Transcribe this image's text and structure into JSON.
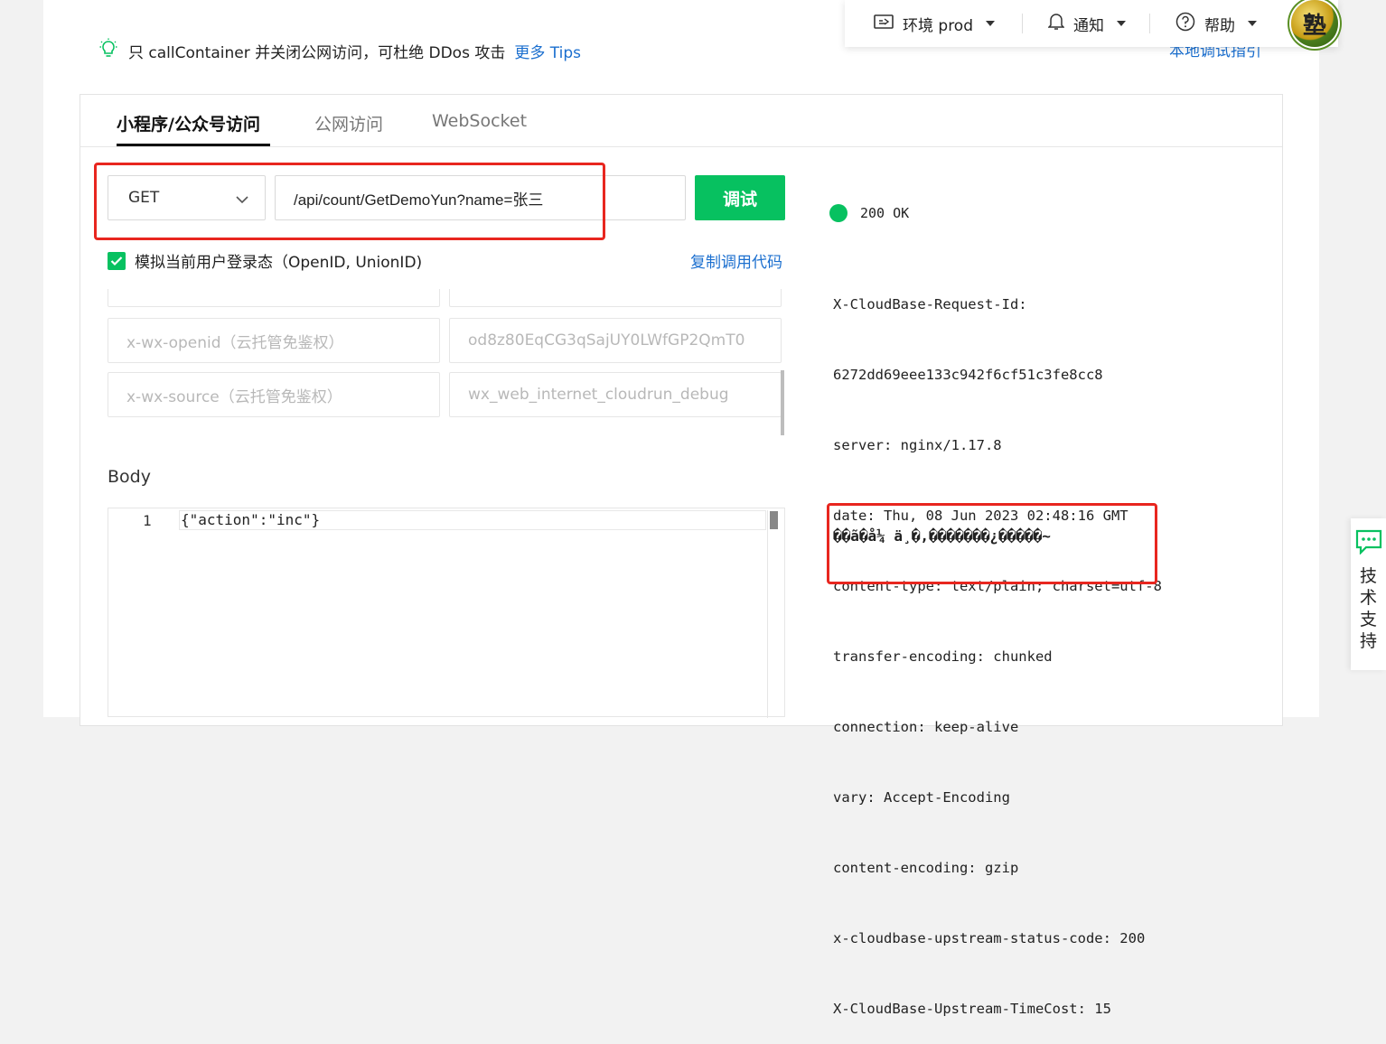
{
  "tip": {
    "text": "只 callContainer 并关闭公网访问，可杜绝 DDos 攻击",
    "more_link": "更多 Tips"
  },
  "topbar": {
    "env_label": "环境 prod",
    "notify_label": "通知",
    "help_label": "帮助",
    "avatar_text": "塾",
    "local_debug_link": "本地调试指引"
  },
  "tabs": [
    {
      "label": "小程序/公众号访问",
      "active": true
    },
    {
      "label": "公网访问",
      "active": false
    },
    {
      "label": "WebSocket",
      "active": false
    }
  ],
  "request": {
    "method": "GET",
    "url": "/api/count/GetDemoYun?name=张三",
    "debug_button": "调试",
    "simulate_login_label": "模拟当前用户登录态（OpenID, UnionID)",
    "simulate_login_checked": true,
    "copy_code_link": "复制调用代码"
  },
  "headers": [
    {
      "key": "x-wx-openid（云托管免鉴权）",
      "value": "od8z80EqCG3qSajUY0LWfGP2QmT0"
    },
    {
      "key": "x-wx-source（云托管免鉴权）",
      "value": "wx_web_internet_cloudrun_debug"
    }
  ],
  "body": {
    "label": "Body",
    "line_number": "1",
    "code": "{\"action\":\"inc\"}"
  },
  "response": {
    "status": "200 OK",
    "status_color": "#07c160",
    "lines": [
      "X-CloudBase-Request-Id:",
      "6272dd69eee133c942f6cf51c3fe8cc8",
      "server: nginx/1.17.8",
      "date: Thu, 08 Jun 2023 02:48:16 GMT",
      "content-type: text/plain; charset=utf-8",
      "transfer-encoding: chunked",
      "connection: keep-alive",
      "vary: Accept-Encoding",
      "content-encoding: gzip",
      "x-cloudbase-upstream-status-code: 200",
      "X-CloudBase-Upstream-TimeCost: 15"
    ],
    "body_text": "��ã�å¼ ä¸�,�������¿�����~"
  },
  "support": {
    "label": "技术支持"
  },
  "colors": {
    "primary": "#07c160",
    "link": "#1b6fcf",
    "highlight_box": "#e8261f"
  }
}
